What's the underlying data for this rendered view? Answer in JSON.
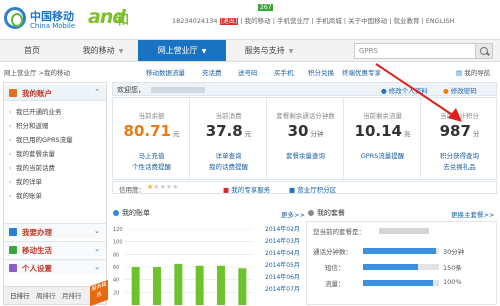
{
  "header": {
    "brand_cn": "中国移动",
    "brand_en": "China Mobile",
    "logo_and": "and",
    "logo_he": "和",
    "badge": "267",
    "phone": "18234024134",
    "phone_tag": "[退出]",
    "top_links": [
      "我的移动",
      "手机营业厅",
      "手机商城",
      "关于中国移动",
      "就业教育",
      "ENGLISH"
    ]
  },
  "nav": {
    "items": [
      {
        "label": "首页"
      },
      {
        "label": "我的移动"
      },
      {
        "label": "网上营业厅"
      },
      {
        "label": "服务与支持"
      }
    ],
    "search_placeholder": "GPRS"
  },
  "subnav": {
    "breadcrumb": "网上营业厅 >我的移动",
    "links": [
      "移动数据流量",
      "充话费",
      "送号码",
      "买手机",
      "积分兑换",
      "终端优惠专享"
    ],
    "my_nav": "我的导航"
  },
  "sidebar": {
    "account_title": "我的账户",
    "items": [
      "我已开通的业务",
      "积分和返赠",
      "我已用的GPRS流量",
      "我的套餐余量",
      "我的当前话费",
      "我的详单",
      "我的账单"
    ],
    "sections": [
      {
        "label": "我要办理"
      },
      {
        "label": "移动生活"
      },
      {
        "label": "个人设置"
      }
    ],
    "rank_tabs": [
      "日排行",
      "周排行",
      "月排行"
    ],
    "flag": "服务精选"
  },
  "welcome": {
    "label": "欢迎您，",
    "links": [
      "修改个人资料",
      "修改密码"
    ]
  },
  "stats": [
    {
      "label": "当前余额",
      "value": "80.71",
      "unit": "元",
      "link1": "马上充值",
      "link2": "个性话费提醒",
      "orange": true
    },
    {
      "label": "当前消费",
      "value": "37.8",
      "unit": "元",
      "link1": "详单查询",
      "link2": "我的话费提醒",
      "orange": false
    },
    {
      "label": "套餐剩余通话分钟数",
      "value": "30",
      "unit": "分钟",
      "link1": "套餐余量查询",
      "link2": "",
      "orange": false
    },
    {
      "label": "当前剩余流量",
      "value": "10.14",
      "unit": "兆",
      "link1": "GPRS流量提醒",
      "link2": "",
      "orange": false
    },
    {
      "label": "当前累计积分",
      "value": "987",
      "unit": "分",
      "link1": "积分获得查询",
      "link2": "去兑换礼品",
      "orange": false
    }
  ],
  "rating": {
    "label": "信用度：",
    "filled_stars": 1,
    "total_stars": 5,
    "link_privilege": "我的专享服务",
    "link_hall": "营业厅积分区"
  },
  "bill_panel": {
    "title": "我的账单",
    "more": "更多>>",
    "months": [
      "2014年02月",
      "2014年03月",
      "2014年04月",
      "2014年05月",
      "2014年06月",
      "2014年07月"
    ]
  },
  "pkg_panel": {
    "title": "我的套餐",
    "more": "更换主套餐>>",
    "name_label": "您当前的套餐是：",
    "call_label": "通话分钟数：",
    "call_value": "30分钟",
    "sms_label": "短信：",
    "sms_value": "150条",
    "data_label": "流量：",
    "data_value": "100%",
    "call_fraction": 0.96,
    "sms_fraction": 0.72,
    "data_fraction": 0.92
  },
  "chart_data": {
    "type": "bar",
    "categories": [
      "",
      "",
      "",
      "",
      "",
      ""
    ],
    "values": [
      20,
      20,
      25,
      22,
      22,
      18
    ],
    "ylim": [
      0,
      20
    ],
    "yticks": [
      20,
      40,
      60,
      80,
      100,
      120
    ],
    "color": "#6cc42c"
  }
}
